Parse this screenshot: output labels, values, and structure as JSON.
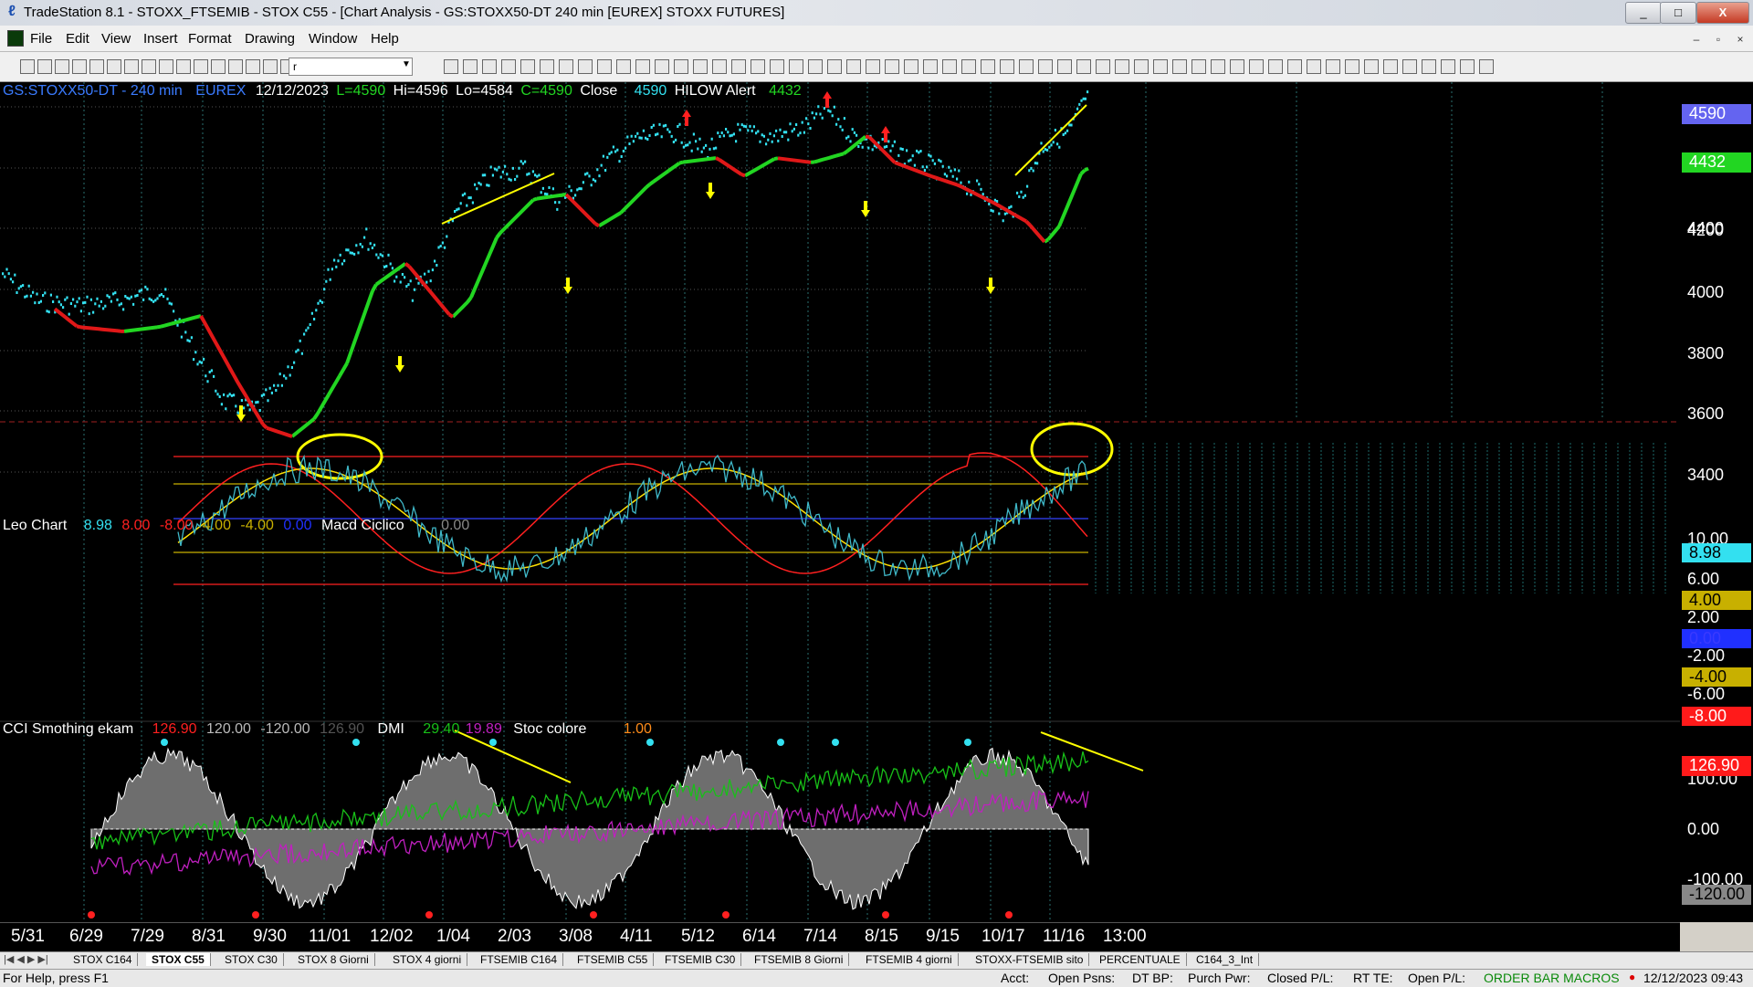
{
  "window": {
    "title": "TradeStation 8.1 - STOXX_FTSEMIB - STOX C55 - [Chart Analysis - GS:STOXX50-DT  240 min  [EUREX] STOXX FUTURES]",
    "controls": {
      "minimize": "_",
      "maximize": "□",
      "close": "X"
    }
  },
  "menu": {
    "items": [
      "File",
      "Edit",
      "View",
      "Insert",
      "Format",
      "Drawing",
      "Window",
      "Help"
    ]
  },
  "toolbar": {
    "combo_value": "r"
  },
  "chart": {
    "header": {
      "symbol": "GS:STOXX50-DT - 240 min",
      "exchange": "EUREX",
      "date": "12/12/2023",
      "last": "L=4590",
      "high": "Hi=4596",
      "low": "Lo=4584",
      "close_eq": "C=4590",
      "close_label": "Close",
      "close_value": "4590",
      "alert_label": "HILOW Alert",
      "alert_value": "4432"
    },
    "price_axis": [
      "4400",
      "4200",
      "4000",
      "3800",
      "3600",
      "3400"
    ],
    "price_flags": {
      "close": "4590",
      "hilow": "4432"
    },
    "leo_panel": {
      "title": "Leo Chart",
      "values": [
        "8.98",
        "8.00",
        "-8.00",
        "4.00",
        "-4.00",
        "0.00"
      ],
      "macd_label": "Macd Ciclico",
      "macd_value": "0.00",
      "axis": [
        "10.00",
        "6.00",
        "2.00",
        "-2.00",
        "-6.00"
      ],
      "flags": {
        "value": "8.98",
        "upper4": "4.00",
        "zero": "0.00",
        "lower4": "-4.00",
        "lower8": "-8.00"
      }
    },
    "cci_panel": {
      "title": "CCI Smothing ekam",
      "values": [
        "126.90",
        "120.00",
        "-120.00",
        "126.90"
      ],
      "dmi_label": "DMI",
      "dmi_values": [
        "29.40",
        "19.89"
      ],
      "stoc_label": "Stoc colore",
      "stoc_value": "1.00",
      "axis": [
        "100.00",
        "0.00",
        "-100.00"
      ],
      "flags": {
        "value": "126.90",
        "lower": "-120.00"
      }
    },
    "date_axis": [
      "5/31",
      "6/29",
      "7/29",
      "8/31",
      "9/30",
      "11/01",
      "12/02",
      "1/04",
      "2/03",
      "3/08",
      "4/11",
      "5/12",
      "6/14",
      "7/14",
      "8/15",
      "9/15",
      "10/17",
      "11/16",
      "13:00"
    ]
  },
  "tabs": {
    "items": [
      "STOX C164",
      "STOX C55",
      "STOX C30",
      "STOX 8 Giorni",
      "STOX 4 giorni",
      "FTSEMIB C164",
      "FTSEMIB C55",
      "FTSEMIB C30",
      "FTSEMIB 8 Giorni",
      "FTSEMIB 4 giorni",
      "STOXX-FTSEMIB sito",
      "PERCENTUALE",
      "C164_3_Int"
    ],
    "active": "STOX C55"
  },
  "status": {
    "help": "For Help, press F1",
    "acct": "Acct:",
    "open_psns": "Open Psns:",
    "dt_bp": "DT BP:",
    "purch_pwr": "Purch Pwr:",
    "closed_pl": "Closed P/L:",
    "rt_te": "RT TE:",
    "open_pl": "Open P/L:",
    "macros": "ORDER BAR MACROS",
    "datetime": "12/12/2023 09:43"
  },
  "colors": {
    "price": "#33e0f0",
    "up_line": "#22d622",
    "down_line": "#e01818",
    "annotation": "#ffff00",
    "leo_fast": "#ff2020",
    "leo_slow": "#ffe000",
    "cci_fill": "#6e6e6e",
    "dmi_plus": "#18c018",
    "dmi_minus": "#c020c0",
    "stoc": "#ff8c1a"
  }
}
